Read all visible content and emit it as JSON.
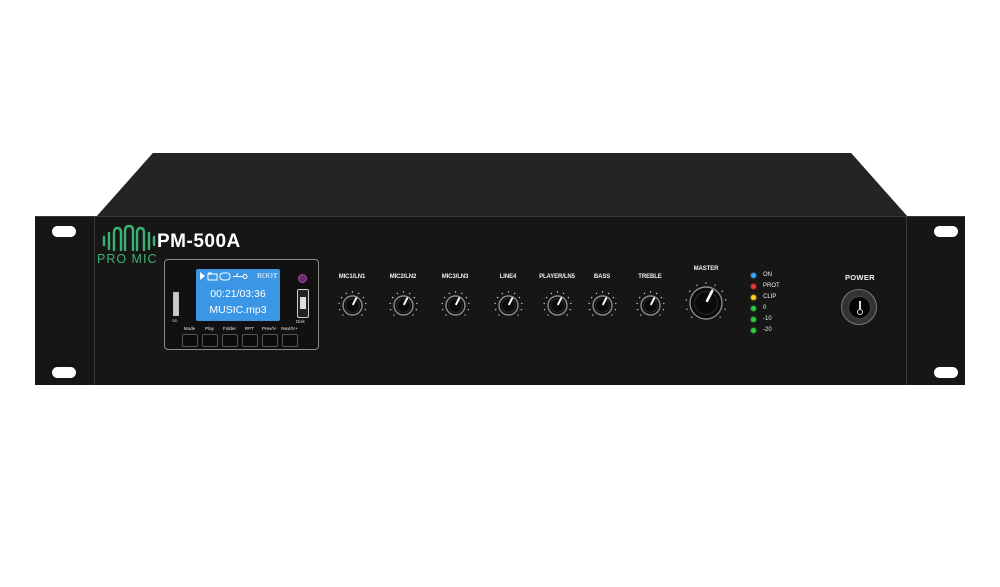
{
  "device": {
    "brand": "PRO MIC",
    "model": "PM-500A"
  },
  "player": {
    "lcd": {
      "status_icons": [
        "music-note-icon",
        "folder-icon",
        "repeat-icon",
        "usb-icon"
      ],
      "status_text": "ROOT",
      "time": "00:21/03:36",
      "filename": "MUSIC.mp3"
    },
    "sd_label": "SD",
    "usb_label": "Disk",
    "buttons": [
      "Mode",
      "Play",
      "Folder",
      "RPT",
      "Prev/V-",
      "Next/V+"
    ]
  },
  "knobs": [
    {
      "label": "MIC1/LN1",
      "level": 0.6
    },
    {
      "label": "MIC2/LN2",
      "level": 0.6
    },
    {
      "label": "MIC3/LN3",
      "level": 0.6
    },
    {
      "label": "LINE4",
      "level": 0.6
    },
    {
      "label": "PLAYER/LN5",
      "level": 0.6
    },
    {
      "label": "BASS",
      "level": 0.6
    },
    {
      "label": "TREBLE",
      "level": 0.6
    }
  ],
  "master": {
    "label": "MASTER",
    "level": 0.6
  },
  "indicators": [
    {
      "label": "ON",
      "color": "#3aa6ff"
    },
    {
      "label": "PROT",
      "color": "#e53935"
    },
    {
      "label": "CLIP",
      "color": "#ffd21f"
    },
    {
      "label": "0",
      "color": "#2ecc40"
    },
    {
      "label": "-10",
      "color": "#2ecc40"
    },
    {
      "label": "-20",
      "color": "#2ecc40"
    }
  ],
  "power": {
    "label": "POWER"
  },
  "colors": {
    "chassis": "#161616",
    "brand_green": "#3bb273",
    "lcd_blue": "#3b97e6"
  }
}
